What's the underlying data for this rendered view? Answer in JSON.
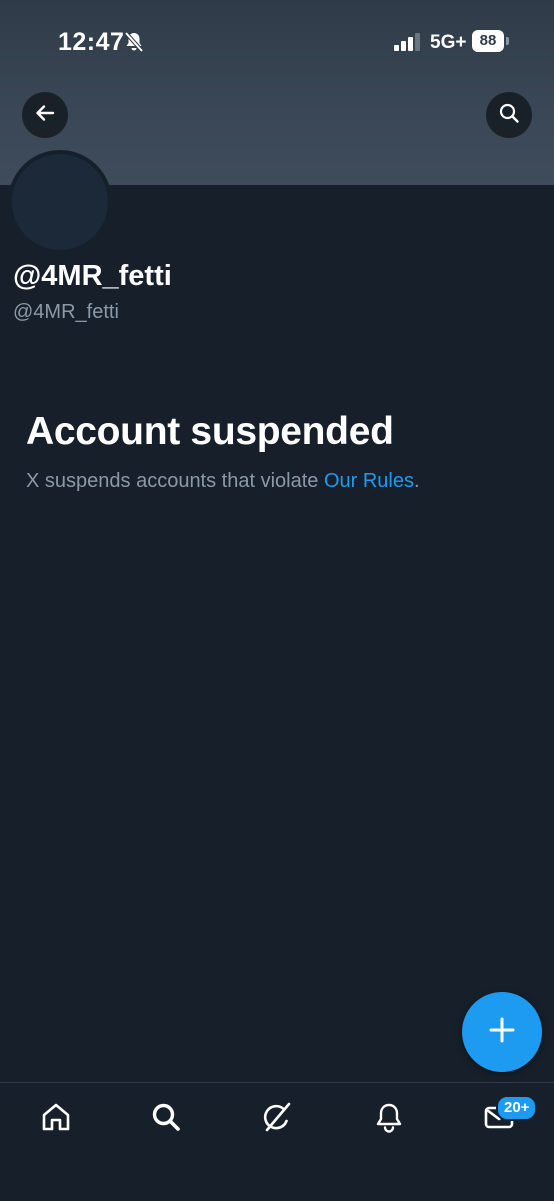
{
  "status_bar": {
    "time": "12:47",
    "network": "5G+",
    "battery": "88"
  },
  "profile": {
    "display_name": "@4MR_fetti",
    "handle": "@4MR_fetti"
  },
  "suspension": {
    "title": "Account suspended",
    "message_prefix": "X suspends accounts that violate ",
    "link_label": "Our Rules",
    "message_suffix": "."
  },
  "bottom_nav": {
    "items": [
      "home-icon",
      "search-icon",
      "grok-icon",
      "notifications-icon",
      "messages-icon"
    ],
    "messages_badge": "20+"
  },
  "colors": {
    "background": "#17202a",
    "accent": "#1d9bf0",
    "secondary_text": "#8b98a5"
  }
}
